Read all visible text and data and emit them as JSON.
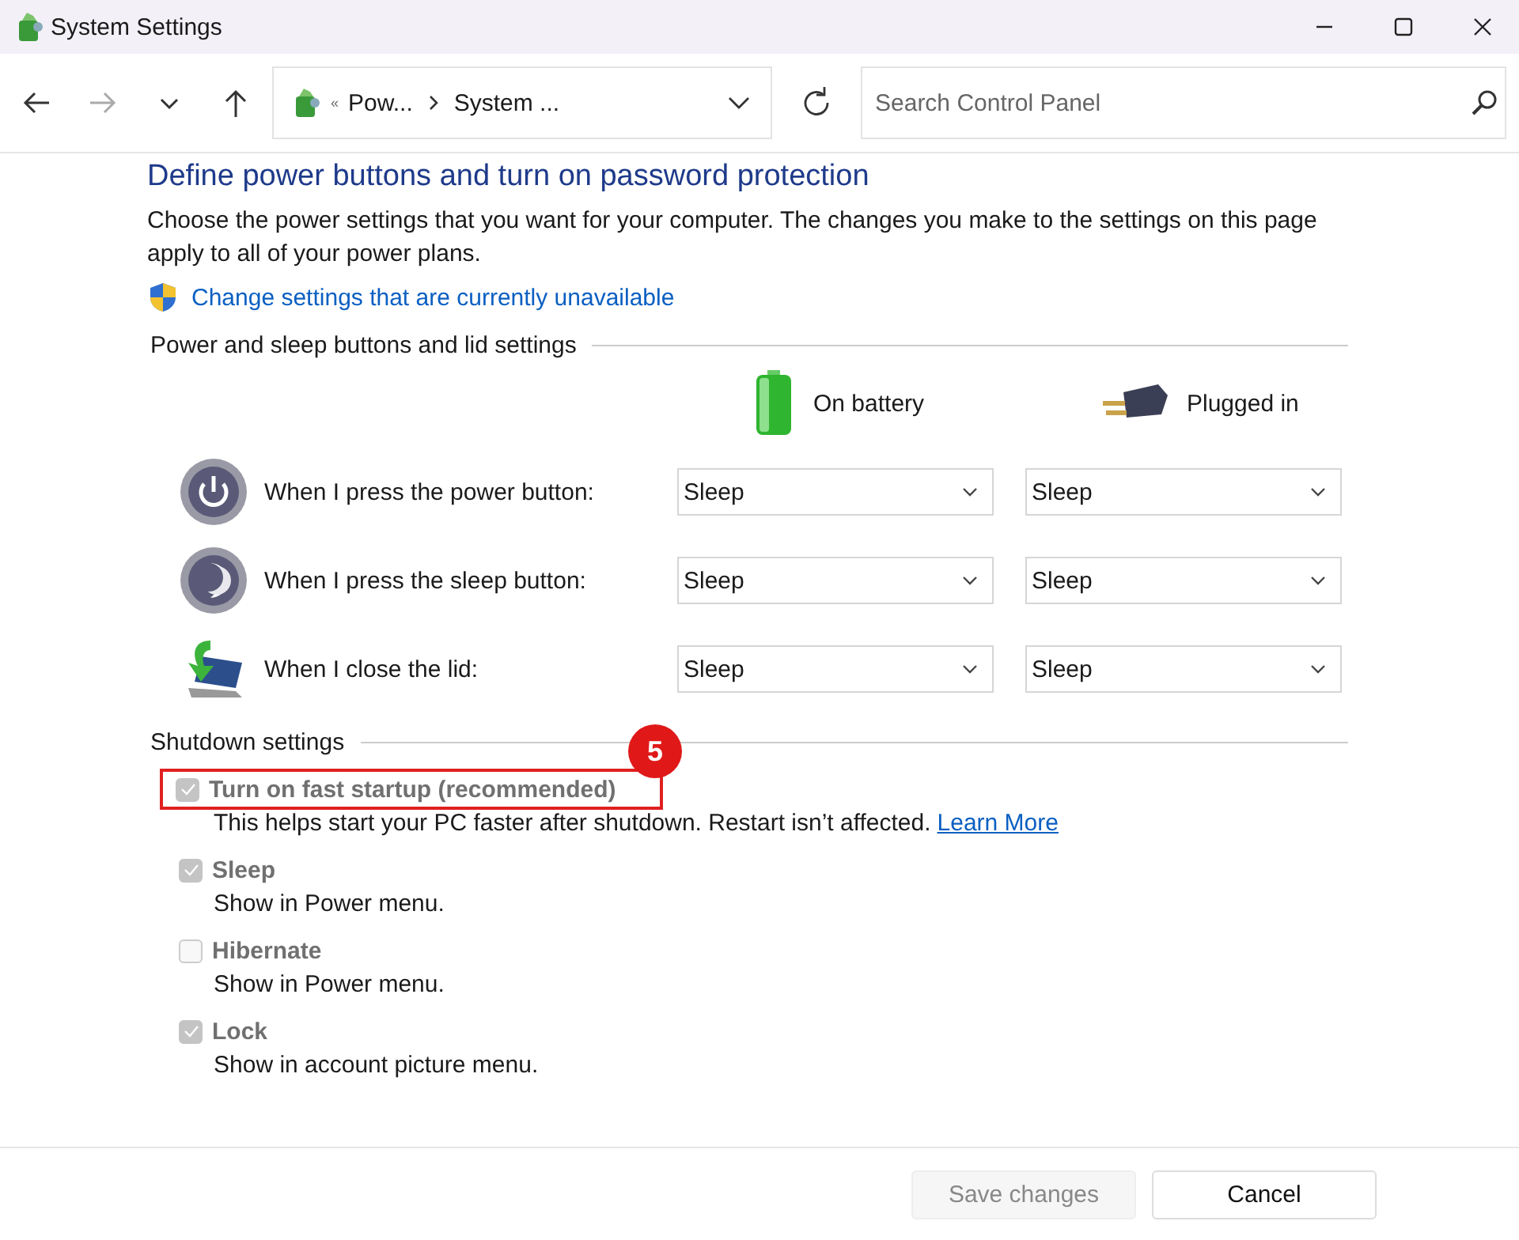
{
  "window": {
    "title": "System Settings"
  },
  "toolbar": {
    "breadcrumb": [
      {
        "label": "Pow..."
      },
      {
        "label": "System ..."
      }
    ],
    "breadcrumb_prefix": "«",
    "search": {
      "placeholder": "Search Control Panel"
    }
  },
  "page": {
    "heading": "Define power buttons and turn on password protection",
    "intro": "Choose the power settings that you want for your computer. The changes you make to the settings on this page apply to all of your power plans.",
    "admin_link": "Change settings that are currently unavailable"
  },
  "buttons_section": {
    "title": "Power and sleep buttons and lid settings",
    "columns": [
      {
        "kind": "battery",
        "label": "On battery"
      },
      {
        "kind": "plug",
        "label": "Plugged in"
      }
    ],
    "rows": [
      {
        "kind": "power",
        "label": "When I press the power button:",
        "values": [
          "Sleep",
          "Sleep"
        ]
      },
      {
        "kind": "sleep",
        "label": "When I press the sleep button:",
        "values": [
          "Sleep",
          "Sleep"
        ]
      },
      {
        "kind": "lid",
        "label": "When I close the lid:",
        "values": [
          "Sleep",
          "Sleep"
        ]
      }
    ]
  },
  "shutdown_section": {
    "title": "Shutdown settings",
    "options": [
      {
        "label": "Turn on fast startup (recommended)",
        "checked": true,
        "disabled": true,
        "highlighted": true,
        "description": "This helps start your PC faster after shutdown. Restart isn’t affected.",
        "link": "Learn More"
      },
      {
        "label": "Sleep",
        "checked": true,
        "disabled": true,
        "highlighted": false,
        "description": "Show in Power menu."
      },
      {
        "label": "Hibernate",
        "checked": false,
        "disabled": true,
        "highlighted": false,
        "description": "Show in Power menu."
      },
      {
        "label": "Lock",
        "checked": true,
        "disabled": true,
        "highlighted": false,
        "description": "Show in account picture menu."
      }
    ]
  },
  "annotation": {
    "label": "5"
  },
  "footer": {
    "buttons": [
      {
        "label": "Save changes",
        "disabled": true
      },
      {
        "label": "Cancel",
        "disabled": false
      }
    ]
  }
}
